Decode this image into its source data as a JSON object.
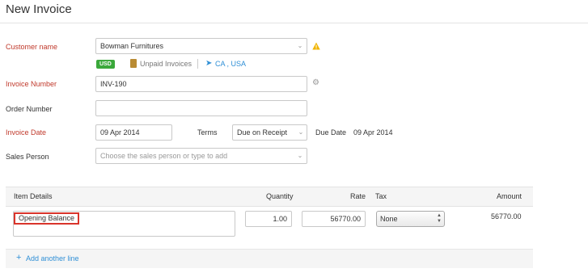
{
  "page": {
    "title": "New Invoice"
  },
  "customer": {
    "label": "Customer name",
    "value": "Bowman Furnitures",
    "currency_badge": "USD",
    "unpaid_invoices": "Unpaid Invoices",
    "location": "CA , USA"
  },
  "invoice_number": {
    "label": "Invoice Number",
    "value": "INV-190"
  },
  "order_number": {
    "label": "Order Number",
    "value": ""
  },
  "invoice_date": {
    "label": "Invoice Date",
    "value": "09 Apr 2014"
  },
  "terms": {
    "label": "Terms",
    "value": "Due on Receipt"
  },
  "due_date": {
    "label": "Due Date",
    "value": "09 Apr 2014"
  },
  "sales_person": {
    "label": "Sales Person",
    "placeholder": "Choose the sales person or type to add"
  },
  "items_table": {
    "headers": {
      "item": "Item Details",
      "quantity": "Quantity",
      "rate": "Rate",
      "tax": "Tax",
      "amount": "Amount"
    },
    "rows": [
      {
        "item": "Opening Balance",
        "quantity": "1.00",
        "rate": "56770.00",
        "tax": "None",
        "amount": "56770.00"
      }
    ],
    "add_line": "Add another line"
  },
  "colors": {
    "required_label": "#c0392b",
    "link": "#2f8fd6",
    "badge": "#3aa83a",
    "highlight": "#d9342b"
  }
}
